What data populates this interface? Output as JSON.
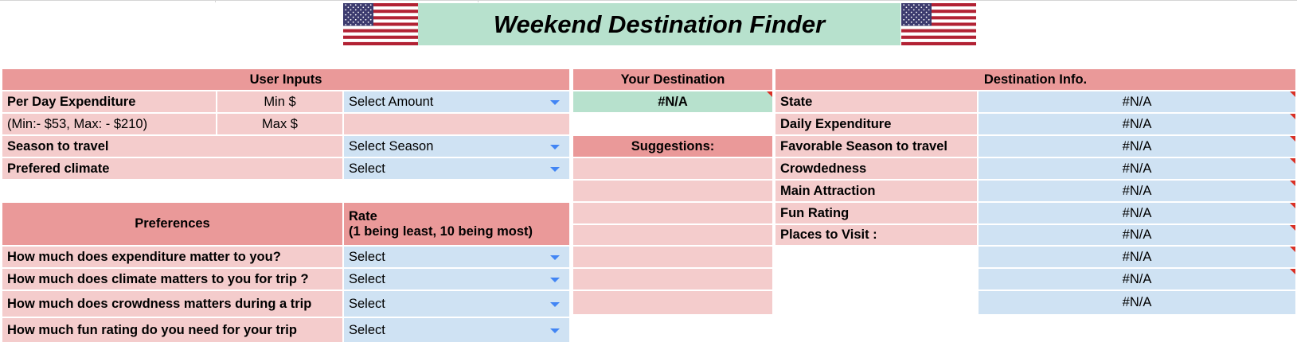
{
  "title": "Weekend Destination Finder",
  "flag_icon": "us-flag-icon",
  "colors": {
    "header": "#ea9999",
    "section": "#f4cccc",
    "input": "#cfe2f3",
    "result": "#b7e1cd",
    "dropdown_arrow": "#4285f4",
    "note_marker": "#d93025"
  },
  "user_inputs": {
    "header": "User Inputs",
    "per_day_label": "Per Day Expenditure",
    "range_hint": "(Min:- $53, Max: - $210)",
    "min_label": "Min $",
    "max_label": "Max $",
    "amount_select": "Select Amount",
    "season_label": "Season to travel",
    "season_select": "Select Season",
    "climate_label": "Prefered climate",
    "climate_select": "Select"
  },
  "preferences": {
    "header": "Preferences",
    "rate_header": "Rate",
    "rate_subheader": "(1 being least, 10 being most)",
    "rows": [
      {
        "question": "How much does expenditure matter to you?",
        "value": "Select"
      },
      {
        "question": "How much does climate matters to you for trip ?",
        "value": "Select"
      },
      {
        "question": "How much does crowdness matters during a trip",
        "value": "Select"
      },
      {
        "question": "How much fun rating do you need for your trip",
        "value": "Select"
      }
    ]
  },
  "destination": {
    "header": "Your Destination",
    "value": "#N/A",
    "suggestions_header": "Suggestions:"
  },
  "info": {
    "header": "Destination Info.",
    "rows": [
      {
        "label": "State",
        "value": "#N/A"
      },
      {
        "label": "Daily Expenditure",
        "value": "#N/A"
      },
      {
        "label": "Favorable Season to travel",
        "value": "#N/A"
      },
      {
        "label": "Crowdedness",
        "value": "#N/A"
      },
      {
        "label": "Main Attraction",
        "value": "#N/A"
      },
      {
        "label": "Fun Rating",
        "value": "#N/A"
      },
      {
        "label": "Places to Visit :",
        "value": "#N/A"
      }
    ],
    "extra_values": [
      "#N/A",
      "#N/A",
      "#N/A"
    ]
  }
}
